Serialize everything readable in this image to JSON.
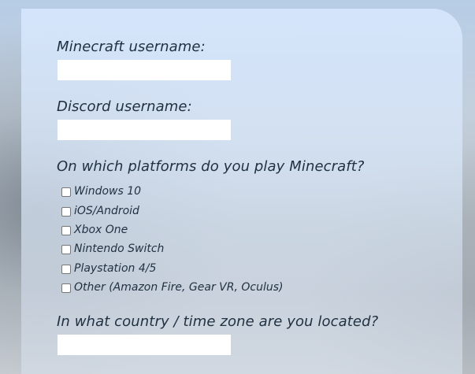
{
  "form": {
    "minecraft_username": {
      "label": "Minecraft username:",
      "value": ""
    },
    "discord_username": {
      "label": "Discord username:",
      "value": ""
    },
    "platforms": {
      "label": "On which platforms do you play Minecraft?",
      "options": [
        {
          "label": "Windows 10",
          "checked": false
        },
        {
          "label": "iOS/Android",
          "checked": false
        },
        {
          "label": "Xbox One",
          "checked": false
        },
        {
          "label": "Nintendo Switch",
          "checked": false
        },
        {
          "label": "Playstation 4/5",
          "checked": false
        },
        {
          "label": "Other (Amazon Fire, Gear VR, Oculus)",
          "checked": false
        }
      ]
    },
    "location": {
      "label": "In what country / time zone are you located?",
      "value": ""
    }
  }
}
